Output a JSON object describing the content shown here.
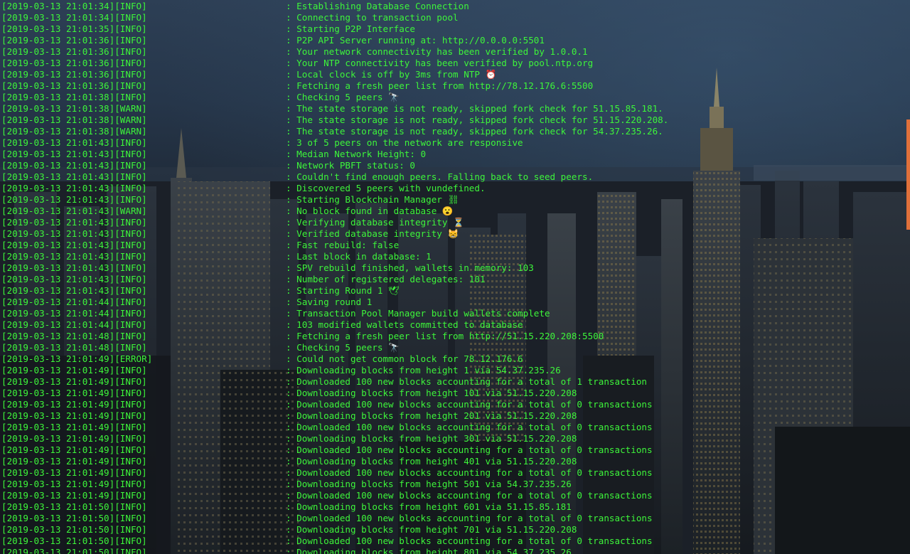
{
  "colors": {
    "terminal_text": "#3df53a",
    "scrollbar_thumb": "#e0703a"
  },
  "log_lines": [
    {
      "prefix": "[2019-03-13 21:01:34][INFO]",
      "message": ": Establishing Database Connection"
    },
    {
      "prefix": "[2019-03-13 21:01:34][INFO]",
      "message": ": Connecting to transaction pool"
    },
    {
      "prefix": "[2019-03-13 21:01:35][INFO]",
      "message": ": Starting P2P Interface"
    },
    {
      "prefix": "[2019-03-13 21:01:36][INFO]",
      "message": ": P2P API Server running at: http://0.0.0.0:5501"
    },
    {
      "prefix": "[2019-03-13 21:01:36][INFO]",
      "message": ": Your network connectivity has been verified by 1.0.0.1"
    },
    {
      "prefix": "[2019-03-13 21:01:36][INFO]",
      "message": ": Your NTP connectivity has been verified by pool.ntp.org"
    },
    {
      "prefix": "[2019-03-13 21:01:36][INFO]",
      "message": ": Local clock is off by 3ms from NTP ⏰"
    },
    {
      "prefix": "[2019-03-13 21:01:36][INFO]",
      "message": ": Fetching a fresh peer list from http://78.12.176.6:5500"
    },
    {
      "prefix": "[2019-03-13 21:01:38][INFO]",
      "message": ": Checking 5 peers 🔭"
    },
    {
      "prefix": "[2019-03-13 21:01:38][WARN]",
      "message": ": The state storage is not ready, skipped fork check for 51.15.85.181."
    },
    {
      "prefix": "[2019-03-13 21:01:38][WARN]",
      "message": ": The state storage is not ready, skipped fork check for 51.15.220.208."
    },
    {
      "prefix": "[2019-03-13 21:01:38][WARN]",
      "message": ": The state storage is not ready, skipped fork check for 54.37.235.26."
    },
    {
      "prefix": "[2019-03-13 21:01:43][INFO]",
      "message": ": 3 of 5 peers on the network are responsive"
    },
    {
      "prefix": "[2019-03-13 21:01:43][INFO]",
      "message": ": Median Network Height: 0"
    },
    {
      "prefix": "[2019-03-13 21:01:43][INFO]",
      "message": ": Network PBFT status: 0"
    },
    {
      "prefix": "[2019-03-13 21:01:43][INFO]",
      "message": ": Couldn't find enough peers. Falling back to seed peers."
    },
    {
      "prefix": "[2019-03-13 21:01:43][INFO]",
      "message": ": Discovered 5 peers with vundefined."
    },
    {
      "prefix": "[2019-03-13 21:01:43][INFO]",
      "message": ": Starting Blockchain Manager ⛓"
    },
    {
      "prefix": "[2019-03-13 21:01:43][WARN]",
      "message": ": No block found in database 😮"
    },
    {
      "prefix": "[2019-03-13 21:01:43][INFO]",
      "message": ": Verifying database integrity ⏳"
    },
    {
      "prefix": "[2019-03-13 21:01:43][INFO]",
      "message": ": Verified database integrity 😸"
    },
    {
      "prefix": "[2019-03-13 21:01:43][INFO]",
      "message": ": Fast rebuild: false"
    },
    {
      "prefix": "[2019-03-13 21:01:43][INFO]",
      "message": ": Last block in database: 1"
    },
    {
      "prefix": "[2019-03-13 21:01:43][INFO]",
      "message": ": SPV rebuild finished, wallets in memory: 103"
    },
    {
      "prefix": "[2019-03-13 21:01:43][INFO]",
      "message": ": Number of registered delegates: 101"
    },
    {
      "prefix": "[2019-03-13 21:01:43][INFO]",
      "message": ": Starting Round 1 🕊"
    },
    {
      "prefix": "[2019-03-13 21:01:44][INFO]",
      "message": ": Saving round 1"
    },
    {
      "prefix": "[2019-03-13 21:01:44][INFO]",
      "message": ": Transaction Pool Manager build wallets complete"
    },
    {
      "prefix": "[2019-03-13 21:01:44][INFO]",
      "message": ": 103 modified wallets committed to database"
    },
    {
      "prefix": "[2019-03-13 21:01:48][INFO]",
      "message": ": Fetching a fresh peer list from http://51.15.220.208:5500"
    },
    {
      "prefix": "[2019-03-13 21:01:48][INFO]",
      "message": ": Checking 5 peers 🔭"
    },
    {
      "prefix": "[2019-03-13 21:01:49][ERROR]",
      "message": ": Could not get common block for 78.12.176.6"
    },
    {
      "prefix": "[2019-03-13 21:01:49][INFO]",
      "message": ": Downloading blocks from height 1 via 54.37.235.26"
    },
    {
      "prefix": "[2019-03-13 21:01:49][INFO]",
      "message": ": Downloaded 100 new blocks accounting for a total of 1 transaction"
    },
    {
      "prefix": "[2019-03-13 21:01:49][INFO]",
      "message": ": Downloading blocks from height 101 via 51.15.220.208"
    },
    {
      "prefix": "[2019-03-13 21:01:49][INFO]",
      "message": ": Downloaded 100 new blocks accounting for a total of 0 transactions"
    },
    {
      "prefix": "[2019-03-13 21:01:49][INFO]",
      "message": ": Downloading blocks from height 201 via 51.15.220.208"
    },
    {
      "prefix": "[2019-03-13 21:01:49][INFO]",
      "message": ": Downloaded 100 new blocks accounting for a total of 0 transactions"
    },
    {
      "prefix": "[2019-03-13 21:01:49][INFO]",
      "message": ": Downloading blocks from height 301 via 51.15.220.208"
    },
    {
      "prefix": "[2019-03-13 21:01:49][INFO]",
      "message": ": Downloaded 100 new blocks accounting for a total of 0 transactions"
    },
    {
      "prefix": "[2019-03-13 21:01:49][INFO]",
      "message": ": Downloading blocks from height 401 via 51.15.220.208"
    },
    {
      "prefix": "[2019-03-13 21:01:49][INFO]",
      "message": ": Downloaded 100 new blocks accounting for a total of 0 transactions"
    },
    {
      "prefix": "[2019-03-13 21:01:49][INFO]",
      "message": ": Downloading blocks from height 501 via 54.37.235.26"
    },
    {
      "prefix": "[2019-03-13 21:01:49][INFO]",
      "message": ": Downloaded 100 new blocks accounting for a total of 0 transactions"
    },
    {
      "prefix": "[2019-03-13 21:01:50][INFO]",
      "message": ": Downloading blocks from height 601 via 51.15.85.181"
    },
    {
      "prefix": "[2019-03-13 21:01:50][INFO]",
      "message": ": Downloaded 100 new blocks accounting for a total of 0 transactions"
    },
    {
      "prefix": "[2019-03-13 21:01:50][INFO]",
      "message": ": Downloading blocks from height 701 via 51.15.220.208"
    },
    {
      "prefix": "[2019-03-13 21:01:50][INFO]",
      "message": ": Downloaded 100 new blocks accounting for a total of 0 transactions"
    },
    {
      "prefix": "[2019-03-13 21:01:50][INFO]",
      "message": ": Downloading blocks from height 801 via 54.37.235.26"
    }
  ]
}
